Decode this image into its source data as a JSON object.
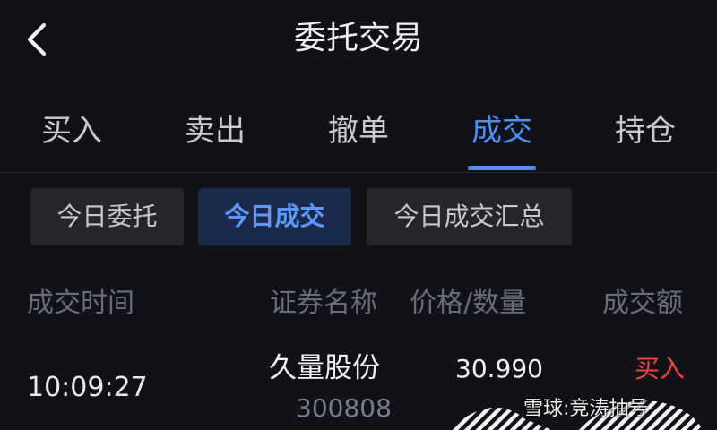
{
  "header": {
    "title": "委托交易"
  },
  "tabs": [
    {
      "label": "买入",
      "active": false
    },
    {
      "label": "卖出",
      "active": false
    },
    {
      "label": "撤单",
      "active": false
    },
    {
      "label": "成交",
      "active": true
    },
    {
      "label": "持仓",
      "active": false
    }
  ],
  "subtabs": [
    {
      "label": "今日委托",
      "active": false
    },
    {
      "label": "今日成交",
      "active": true
    },
    {
      "label": "今日成交汇总",
      "active": false
    }
  ],
  "table": {
    "columns": [
      "成交时间",
      "证券名称",
      "价格/数量",
      "成交额"
    ],
    "rows": [
      {
        "time": "10:09:27",
        "name": "久量股份",
        "code": "300808",
        "price": "30.990",
        "direction": "买入"
      }
    ]
  },
  "watermark": {
    "text": "雪球:竞涛抽号"
  },
  "colors": {
    "background": "#111217",
    "accent": "#4d8ef7",
    "buy": "#e8453c",
    "muted": "#6a6d75"
  }
}
